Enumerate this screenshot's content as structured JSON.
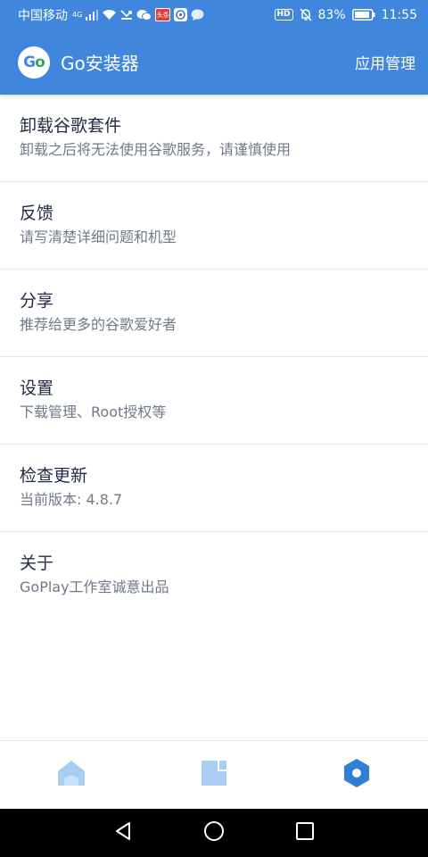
{
  "status_bar": {
    "carrier": "中国移动",
    "network_type": "4G",
    "mini_app_label": "头条",
    "battery_percent": "83%",
    "time": "11:55",
    "hd_label": "HD"
  },
  "app_bar": {
    "logo_text_g": "G",
    "logo_text_o": "o",
    "title": "Go安装器",
    "action_label": "应用管理"
  },
  "menu": {
    "items": [
      {
        "title": "卸载谷歌套件",
        "subtitle": "卸载之后将无法使用谷歌服务，请谨慎使用"
      },
      {
        "title": "反馈",
        "subtitle": "请写清楚详细问题和机型"
      },
      {
        "title": "分享",
        "subtitle": "推荐给更多的谷歌爱好者"
      },
      {
        "title": "设置",
        "subtitle": "下载管理、Root授权等"
      },
      {
        "title": "检查更新",
        "subtitle": "当前版本: 4.8.7"
      },
      {
        "title": "关于",
        "subtitle": "GoPlay工作室诚意出品"
      }
    ]
  },
  "bottom_nav": {
    "items": [
      {
        "icon": "home-icon",
        "active": false
      },
      {
        "icon": "document-icon",
        "active": false
      },
      {
        "icon": "settings-hexagon-icon",
        "active": true
      }
    ]
  },
  "colors": {
    "primary": "#3f86dc",
    "nav_inactive": "#a8cdf3",
    "nav_active": "#2f7fd9",
    "title_text": "#1f2a44",
    "subtitle_text": "#6e7a8a"
  }
}
